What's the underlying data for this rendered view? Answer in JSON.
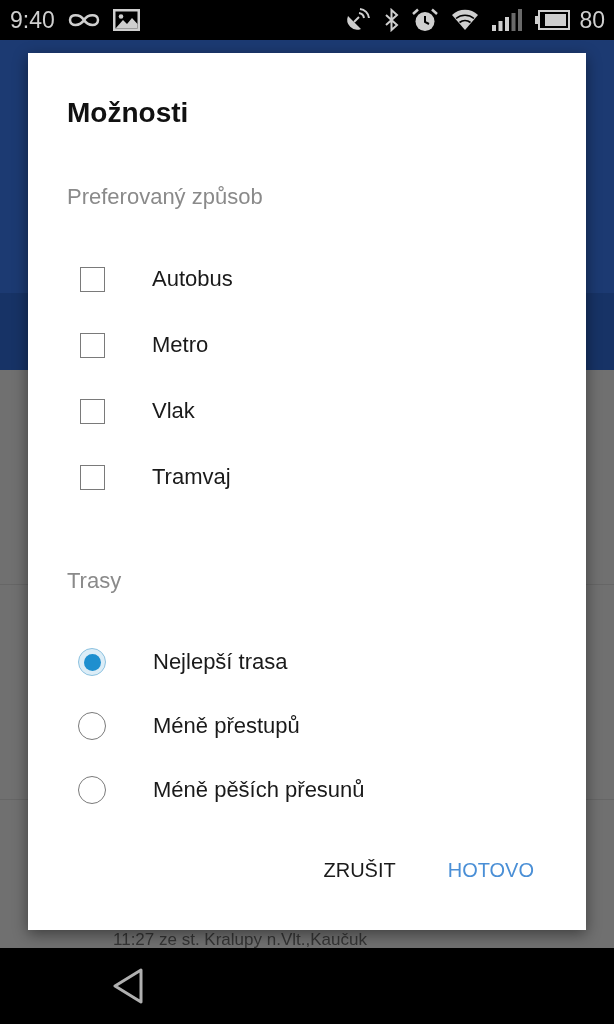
{
  "status_bar": {
    "time": "9:40",
    "battery": "80"
  },
  "background": {
    "list_item_text": "11:27 ze st. Kralupy n.Vlt.,Kaučuk"
  },
  "dialog": {
    "title": "Možnosti",
    "sections": [
      {
        "heading": "Preferovaný způsob",
        "options": [
          {
            "kind": "checkbox",
            "label": "Autobus",
            "checked": false
          },
          {
            "kind": "checkbox",
            "label": "Metro",
            "checked": false
          },
          {
            "kind": "checkbox",
            "label": "Vlak",
            "checked": false
          },
          {
            "kind": "checkbox",
            "label": "Tramvaj",
            "checked": false
          }
        ]
      },
      {
        "heading": "Trasy",
        "options": [
          {
            "kind": "radio",
            "label": "Nejlepší trasa",
            "selected": true
          },
          {
            "kind": "radio",
            "label": "Méně přestupů",
            "selected": false
          },
          {
            "kind": "radio",
            "label": "Méně pěších přesunů",
            "selected": false
          }
        ]
      }
    ],
    "buttons": [
      {
        "kind": "neutral",
        "label": "ZRUŠIT"
      },
      {
        "kind": "primary",
        "label": "HOTOVO"
      }
    ]
  }
}
